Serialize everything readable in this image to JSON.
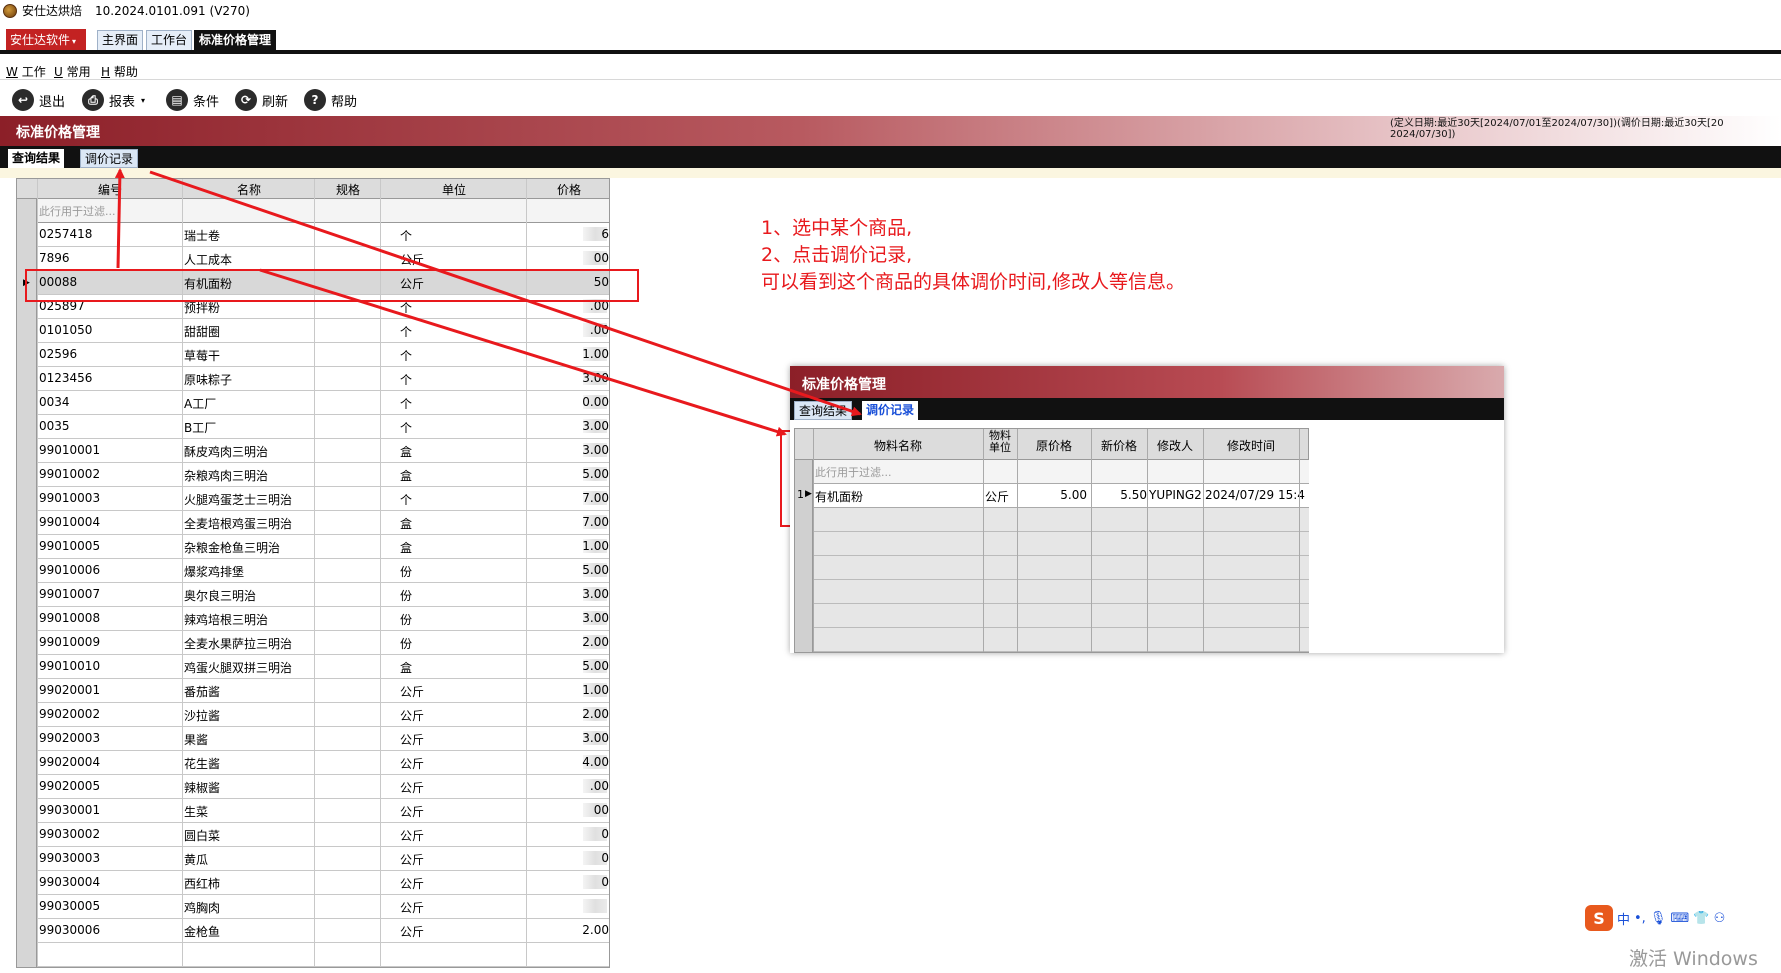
{
  "titlebar": {
    "app": "安仕达烘焙",
    "version": "10.2024.0101.091 (V270)"
  },
  "brand": {
    "label": "安仕达软件",
    "caret": "▾"
  },
  "main_tabs": [
    {
      "label": "主界面"
    },
    {
      "label": "工作台"
    },
    {
      "label": "标准价格管理"
    }
  ],
  "menu": [
    {
      "key": "W",
      "label": "工作"
    },
    {
      "key": "U",
      "label": "常用"
    },
    {
      "key": "H",
      "label": "帮助"
    }
  ],
  "toolbar": [
    {
      "icon": "exit-icon",
      "glyph": "↩",
      "label": "退出"
    },
    {
      "icon": "print-icon",
      "glyph": "⎙",
      "label": "报表",
      "caret": "▾"
    },
    {
      "icon": "filter-icon",
      "glyph": "▤",
      "label": "条件"
    },
    {
      "icon": "refresh-icon",
      "glyph": "⟳",
      "label": "刷新"
    },
    {
      "icon": "help-icon",
      "glyph": "?",
      "label": "帮助"
    }
  ],
  "header": {
    "title": "标准价格管理",
    "info_line1": "(定义日期:最近30天[2024/07/01至2024/07/30])(调价日期:最近30天[20",
    "info_line2": "2024/07/30])"
  },
  "sub_tabs": [
    {
      "label": "查询结果"
    },
    {
      "label": "调价记录"
    }
  ],
  "grid": {
    "headers": [
      "编号",
      "名称",
      "规格",
      "单位",
      "价格"
    ],
    "filter_placeholder": "此行用于过滤...",
    "selected_index": 2,
    "rows": [
      {
        "code": "0257418",
        "name": "瑞士卷",
        "spec": "",
        "unit": "个",
        "price": "6"
      },
      {
        "code": "7896",
        "name": "人工成本",
        "spec": "",
        "unit": "公斤",
        "price": "00"
      },
      {
        "code": "00088",
        "name": "有机面粉",
        "spec": "",
        "unit": "公斤",
        "price": "50"
      },
      {
        "code": "025897",
        "name": "预拌粉",
        "spec": "",
        "unit": "个",
        "price": ".00"
      },
      {
        "code": "0101050",
        "name": "甜甜圈",
        "spec": "",
        "unit": "个",
        "price": ".00"
      },
      {
        "code": "02596",
        "name": "草莓干",
        "spec": "",
        "unit": "个",
        "price": "1.00"
      },
      {
        "code": "0123456",
        "name": "原味粽子",
        "spec": "",
        "unit": "个",
        "price": "3.00"
      },
      {
        "code": "0034",
        "name": "A工厂",
        "spec": "",
        "unit": "个",
        "price": "0.00"
      },
      {
        "code": "0035",
        "name": "B工厂",
        "spec": "",
        "unit": "个",
        "price": "3.00"
      },
      {
        "code": "99010001",
        "name": "酥皮鸡肉三明治",
        "spec": "",
        "unit": "盒",
        "price": "3.00"
      },
      {
        "code": "99010002",
        "name": "杂粮鸡肉三明治",
        "spec": "",
        "unit": "盒",
        "price": "5.00"
      },
      {
        "code": "99010003",
        "name": "火腿鸡蛋芝士三明治",
        "spec": "",
        "unit": "个",
        "price": "7.00"
      },
      {
        "code": "99010004",
        "name": "全麦培根鸡蛋三明治",
        "spec": "",
        "unit": "盒",
        "price": "7.00"
      },
      {
        "code": "99010005",
        "name": "杂粮金枪鱼三明治",
        "spec": "",
        "unit": "盒",
        "price": "1.00"
      },
      {
        "code": "99010006",
        "name": "爆浆鸡排堡",
        "spec": "",
        "unit": "份",
        "price": "5.00"
      },
      {
        "code": "99010007",
        "name": "奥尔良三明治",
        "spec": "",
        "unit": "份",
        "price": "3.00"
      },
      {
        "code": "99010008",
        "name": "辣鸡培根三明治",
        "spec": "",
        "unit": "份",
        "price": "3.00"
      },
      {
        "code": "99010009",
        "name": "全麦水果萨拉三明治",
        "spec": "",
        "unit": "份",
        "price": "2.00"
      },
      {
        "code": "99010010",
        "name": "鸡蛋火腿双拼三明治",
        "spec": "",
        "unit": "盒",
        "price": "5.00"
      },
      {
        "code": "99020001",
        "name": "番茄酱",
        "spec": "",
        "unit": "公斤",
        "price": "1.00"
      },
      {
        "code": "99020002",
        "name": "沙拉酱",
        "spec": "",
        "unit": "公斤",
        "price": "2.00"
      },
      {
        "code": "99020003",
        "name": "果酱",
        "spec": "",
        "unit": "公斤",
        "price": "3.00"
      },
      {
        "code": "99020004",
        "name": "花生酱",
        "spec": "",
        "unit": "公斤",
        "price": "4.00"
      },
      {
        "code": "99020005",
        "name": "辣椒酱",
        "spec": "",
        "unit": "公斤",
        "price": ".00"
      },
      {
        "code": "99030001",
        "name": "生菜",
        "spec": "",
        "unit": "公斤",
        "price": "00"
      },
      {
        "code": "99030002",
        "name": "圆白菜",
        "spec": "",
        "unit": "公斤",
        "price": "0"
      },
      {
        "code": "99030003",
        "name": "黄瓜",
        "spec": "",
        "unit": "公斤",
        "price": "0"
      },
      {
        "code": "99030004",
        "name": "西红柿",
        "spec": "",
        "unit": "公斤",
        "price": "0"
      },
      {
        "code": "99030005",
        "name": "鸡胸肉",
        "spec": "",
        "unit": "公斤",
        "price": ""
      },
      {
        "code": "99030006",
        "name": "金枪鱼",
        "spec": "",
        "unit": "公斤",
        "price": "2.00"
      }
    ]
  },
  "annotation": {
    "line1": "1、选中某个商品,",
    "line2": "2、点击调价记录,",
    "line3": "可以看到这个商品的具体调价时间,修改人等信息。",
    "color": "#e8191d"
  },
  "detail_panel": {
    "title": "标准价格管理",
    "tabs": [
      {
        "label": "查询结果"
      },
      {
        "label": "调价记录"
      }
    ],
    "headers": [
      "物料名称",
      "物料\n单位",
      "原价格",
      "新价格",
      "修改人",
      "修改时间"
    ],
    "filter_placeholder": "此行用于过滤...",
    "row": {
      "index": "1",
      "name": "有机面粉",
      "unit": "公斤",
      "old_price": "5.00",
      "new_price": "5.50",
      "modifier": "YUPING2",
      "time": "2024/07/29 15:4"
    }
  },
  "ime": {
    "logo": "S",
    "mode": "中",
    "punct": "•,",
    "icons": "🎙 ⌨ 👕 ⚇"
  },
  "watermark": "激活 Windows"
}
